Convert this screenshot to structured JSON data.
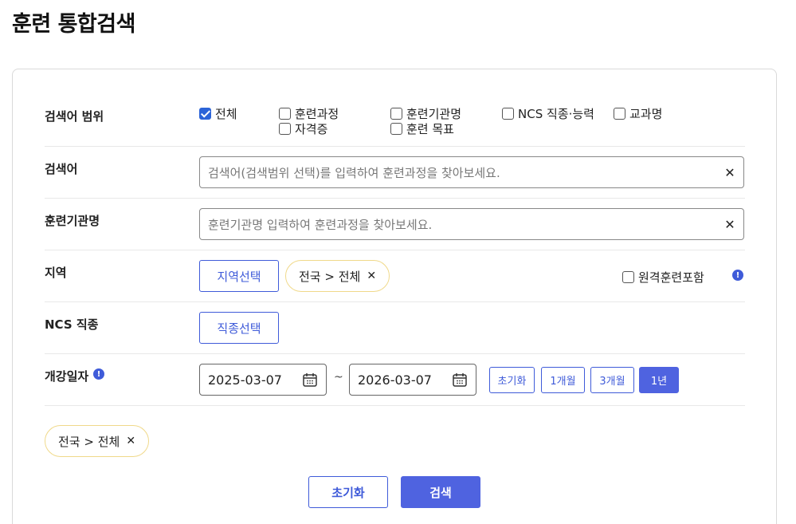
{
  "page": {
    "title": "훈련 통합검색"
  },
  "scope": {
    "label": "검색어 범위",
    "options": [
      {
        "label": "전체",
        "checked": true
      },
      {
        "label": "훈련과정",
        "checked": false
      },
      {
        "label": "훈련기관명",
        "checked": false
      },
      {
        "label": "NCS 직종·능력",
        "checked": false
      },
      {
        "label": "교과명",
        "checked": false
      },
      {
        "label": "자격증",
        "checked": false
      },
      {
        "label": "훈련 목표",
        "checked": false
      }
    ]
  },
  "keyword": {
    "label": "검색어",
    "placeholder": "검색어(검색범위 선택)를 입력하여 훈련과정을 찾아보세요.",
    "clear": "✕"
  },
  "institution": {
    "label": "훈련기관명",
    "placeholder": "훈련기관명 입력하여 훈련과정을 찾아보세요.",
    "clear": "✕"
  },
  "region": {
    "label": "지역",
    "select_label": "지역선택",
    "chip": "전국 > 전체",
    "chip_remove": "✕",
    "remote_label": "원격훈련포함",
    "remote_checked": false,
    "info": "!"
  },
  "ncs": {
    "label": "NCS 직종",
    "select_label": "직종선택"
  },
  "date": {
    "label": "개강일자",
    "info": "!",
    "start": "2025-03-07",
    "separator": "~",
    "end": "2026-03-07",
    "periods": [
      {
        "label": "초기화",
        "active": false
      },
      {
        "label": "1개월",
        "active": false
      },
      {
        "label": "3개월",
        "active": false
      },
      {
        "label": "1년",
        "active": true
      }
    ]
  },
  "selected": {
    "chip": "전국 > 전체",
    "chip_remove": "✕"
  },
  "actions": {
    "reset_label": "초기화",
    "search_label": "검색"
  },
  "colors": {
    "accent": "#4f63e0",
    "checkbox_checked": "#2c64d8",
    "chip_border": "#f0d98a"
  }
}
